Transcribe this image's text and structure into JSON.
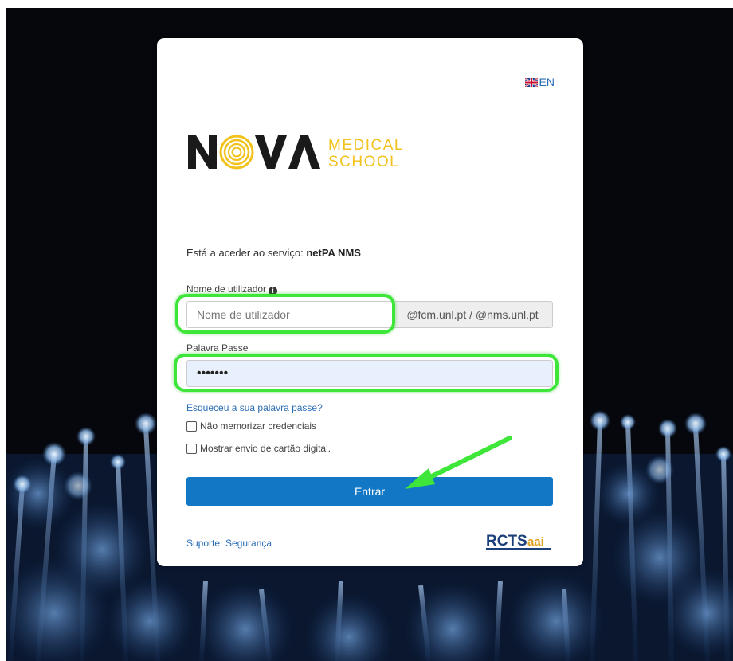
{
  "language": {
    "label": "EN",
    "flag_icon": "uk-flag-icon"
  },
  "logo": {
    "word": "NOVA",
    "line1": "MEDICAL",
    "line2": "SCHOOL",
    "dark_color": "#1a1a1a",
    "accent_color": "#f2c21c"
  },
  "service": {
    "prefix": "Está a aceder ao serviço:",
    "name": "netPA NMS"
  },
  "username": {
    "label": "Nome de utilizador",
    "placeholder": "Nome de utilizador",
    "value": "",
    "domain_suffix": "@fcm.unl.pt / @nms.unl.pt"
  },
  "password": {
    "label": "Palavra Passe",
    "value": "•••••••"
  },
  "forgot_link": "Esqueceu a sua palavra passe?",
  "checkboxes": [
    {
      "label": "Não memorizar credenciais",
      "checked": false
    },
    {
      "label": "Mostrar envio de cartão digital.",
      "checked": false
    }
  ],
  "submit_label": "Entrar",
  "footer": {
    "links": [
      "Suporte",
      "Segurança"
    ],
    "partner_logo": {
      "main": "RCTS",
      "suffix": "aai"
    }
  },
  "colors": {
    "primary": "#1277c4",
    "link": "#2a6db5",
    "highlight": "#3ee63a",
    "background": "#05070c"
  }
}
